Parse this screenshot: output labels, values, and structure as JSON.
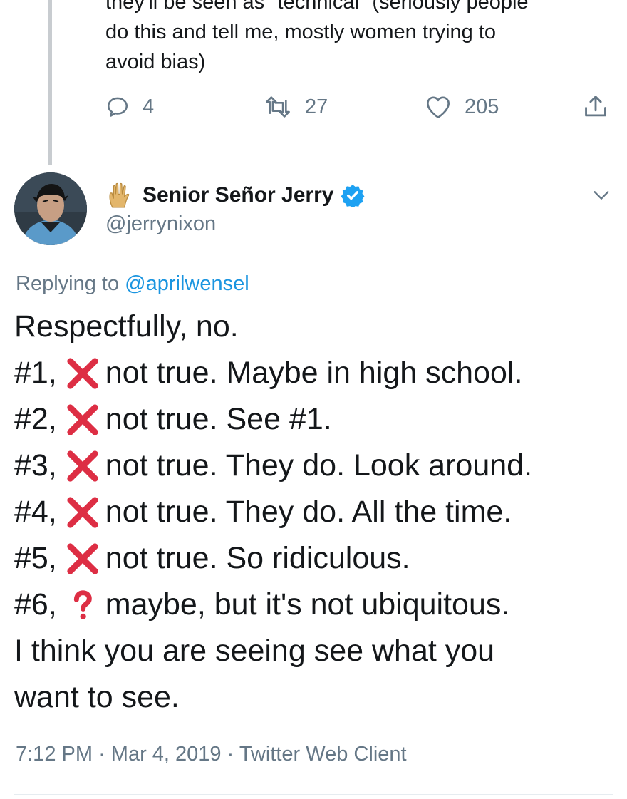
{
  "previous_tweet": {
    "text_lines": [
      "they'll be seen as \"technical\" (seriously people",
      "do this and tell me, mostly women trying to",
      "avoid bias)"
    ],
    "actions": {
      "reply_count": "4",
      "retweet_count": "27",
      "like_count": "205"
    }
  },
  "tweet": {
    "author": {
      "name": "Senior Señor Jerry",
      "handle": "@jerrynixon"
    },
    "replying": {
      "prefix": "Replying to",
      "mention": "@aprilwensel"
    },
    "intro": "Respectfully, no.",
    "points": [
      {
        "num": "#1,",
        "mark": "cross",
        "text": "not true. Maybe in high school."
      },
      {
        "num": "#2,",
        "mark": "cross",
        "text": "not true. See #1."
      },
      {
        "num": "#3,",
        "mark": "cross",
        "text": "not true. They do. Look around."
      },
      {
        "num": "#4,",
        "mark": "cross",
        "text": "not true. They do. All the time."
      },
      {
        "num": "#5,",
        "mark": "cross",
        "text": "not true. So ridiculous."
      },
      {
        "num": "#6,",
        "mark": "question",
        "text": "maybe, but it's not ubiquitous."
      }
    ],
    "closing_lines": [
      "I think you are seeing see what you",
      "want to see."
    ],
    "meta": {
      "time": "7:12 PM",
      "date": "Mar 4, 2019",
      "source": "Twitter Web Client"
    }
  },
  "colors": {
    "text": "#14171a",
    "secondary": "#657786",
    "link": "#1b95e0",
    "verified": "#1da1f2",
    "cross": "#dd2e44"
  },
  "icons": [
    "reply-icon",
    "retweet-icon",
    "like-icon",
    "share-icon",
    "vulcan-hand-icon",
    "verified-badge-icon",
    "chevron-down-icon",
    "cross-mark-icon",
    "question-mark-icon"
  ]
}
